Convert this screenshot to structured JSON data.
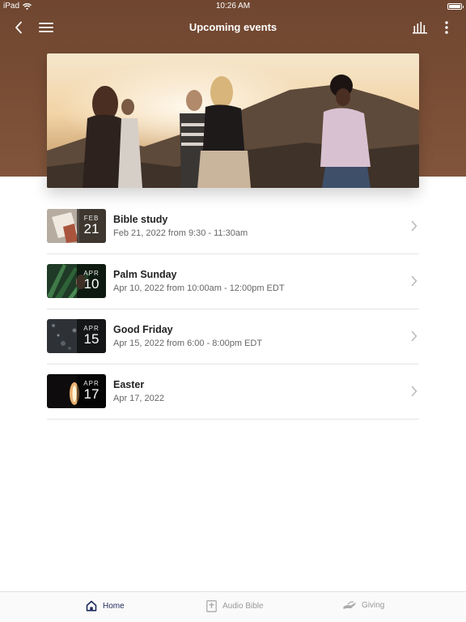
{
  "status_bar": {
    "carrier": "iPad",
    "time": "10:26 AM"
  },
  "nav": {
    "title": "Upcoming events",
    "icons": [
      "back-chevron-icon",
      "menu-icon",
      "audio-bars-icon",
      "more-vertical-icon"
    ]
  },
  "colors": {
    "header": "#7b4f36",
    "tab_active": "#1f2a5a"
  },
  "events": [
    {
      "title": "Bible study",
      "subtitle": "Feb 21, 2022 from 9:30 - 11:30am",
      "month": "FEB",
      "day": "21"
    },
    {
      "title": "Palm Sunday",
      "subtitle": "Apr 10, 2022 from 10:00am - 12:00pm EDT",
      "month": "APR",
      "day": "10"
    },
    {
      "title": "Good Friday",
      "subtitle": "Apr 15, 2022 from 6:00 - 8:00pm EDT",
      "month": "APR",
      "day": "15"
    },
    {
      "title": "Easter",
      "subtitle": "Apr 17, 2022",
      "month": "APR",
      "day": "17"
    }
  ],
  "tabs": [
    {
      "label": "Home",
      "icon": "home-icon",
      "active": true
    },
    {
      "label": "Audio Bible",
      "icon": "bible-icon",
      "active": false
    },
    {
      "label": "Giving",
      "icon": "giving-hand-icon",
      "active": false
    }
  ]
}
